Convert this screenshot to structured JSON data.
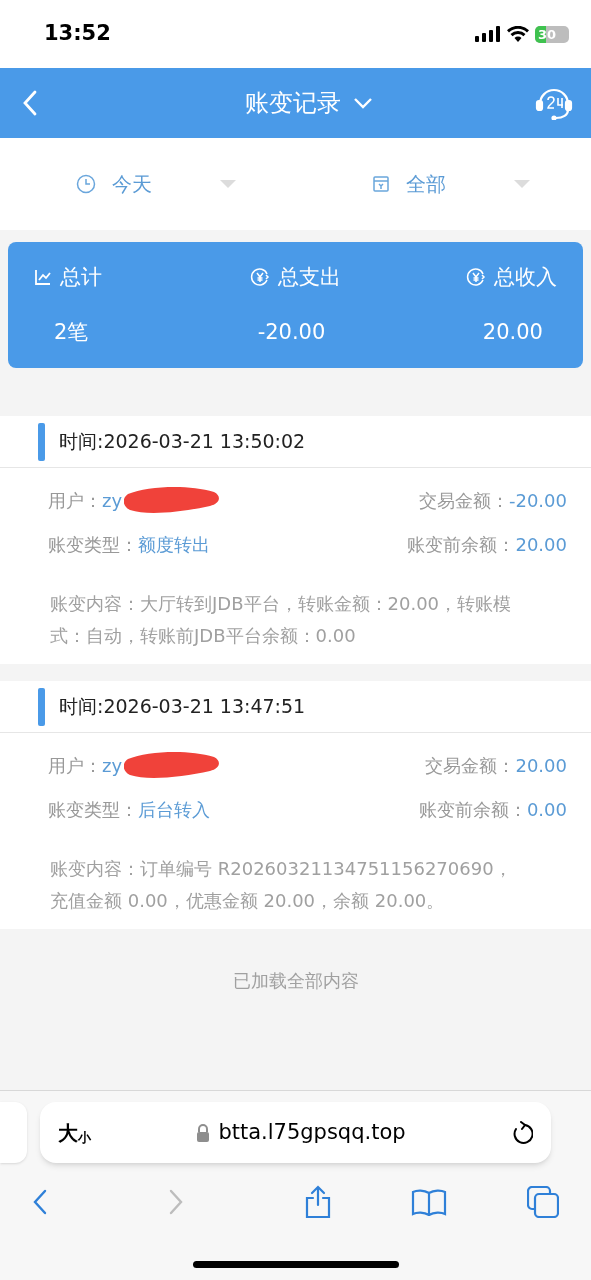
{
  "status_bar": {
    "time": "13:52",
    "battery": "30"
  },
  "header": {
    "title": "账变记录"
  },
  "filters": [
    {
      "label": "今天",
      "kind": "clock"
    },
    {
      "label": "全部",
      "kind": "calendar"
    }
  ],
  "summary": [
    {
      "label": "总计",
      "value": "2笔",
      "kind": "chart"
    },
    {
      "label": "总支出",
      "value": "-20.00",
      "kind": "yen"
    },
    {
      "label": "总收入",
      "value": "20.00",
      "kind": "yen"
    }
  ],
  "records": [
    {
      "time": "时间:2026-03-21 13:50:02",
      "user_label": "用户：",
      "user": "zy",
      "amount_label": "交易金额：",
      "amount": "-20.00",
      "type_label": "账变类型：",
      "type": "额度转出",
      "balance_label": "账变前余额：",
      "balance": "20.00",
      "content": "账变内容：大厅转到JDB平台，转账金额：20.00，转账模式：自动，转账前JDB平台余额：0.00"
    },
    {
      "time": "时间:2026-03-21 13:47:51",
      "user_label": "用户：",
      "user": "zy",
      "amount_label": "交易金额：",
      "amount": "20.00",
      "type_label": "账变类型：",
      "type": "后台转入",
      "balance_label": "账变前余额：",
      "balance": "0.00",
      "content": "账变内容：订单编号 R20260321134751156270690，充值金额 0.00，优惠金额 20.00，余额 20.00。"
    }
  ],
  "footer": "已加载全部内容",
  "browser": {
    "text_size": "大小",
    "url": "btta.l75gpsqq.top"
  }
}
